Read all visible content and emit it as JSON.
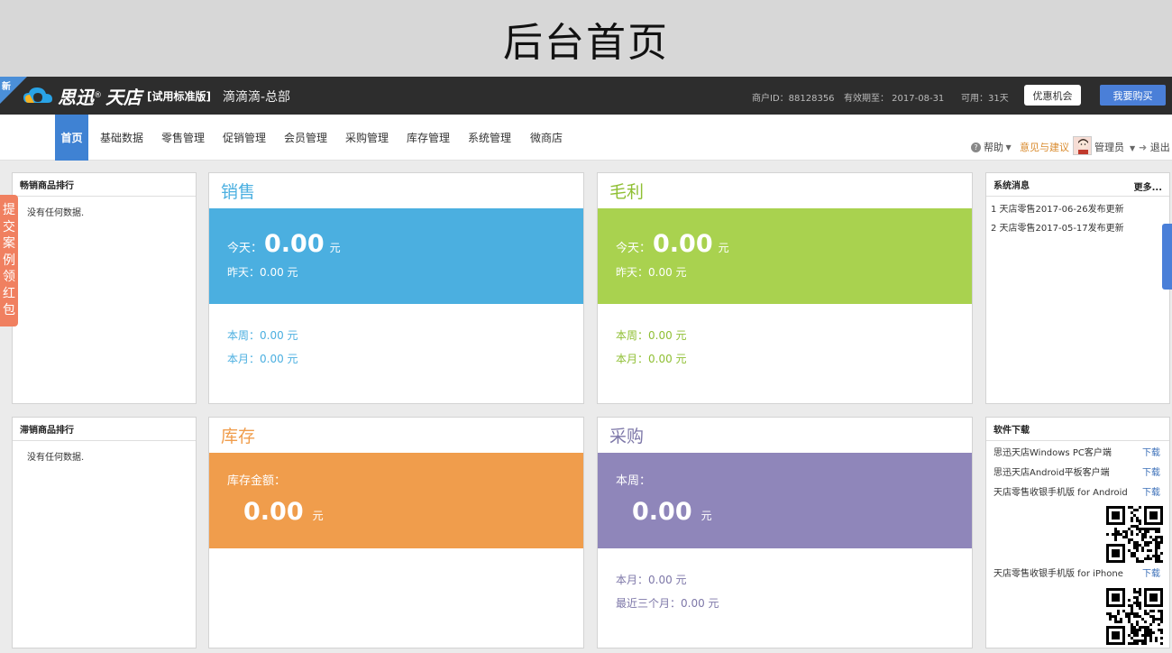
{
  "banner": {
    "title": "后台首页"
  },
  "header": {
    "new_tag": "新",
    "logo_main": "思迅",
    "logo_sup": "®",
    "logo_sub": "天店",
    "edition": "[试用标准版]",
    "store": "滴滴滴-总部",
    "merchant_id": "商户ID：88128356",
    "valid_until": "有效期至： 2017-08-31",
    "available": "可用：31天",
    "promo_label": "优惠机会",
    "buy_label": "我要购买"
  },
  "nav": {
    "items": [
      {
        "label": "首页",
        "active": true
      },
      {
        "label": "基础数据"
      },
      {
        "label": "零售管理"
      },
      {
        "label": "促销管理"
      },
      {
        "label": "会员管理"
      },
      {
        "label": "采购管理"
      },
      {
        "label": "库存管理"
      },
      {
        "label": "系统管理"
      },
      {
        "label": "微商店"
      }
    ],
    "help": "帮助",
    "feedback": "意见与建议",
    "admin": "管理员",
    "logout": "退出"
  },
  "hot_products": {
    "title": "畅销商品排行",
    "empty": "没有任何数据."
  },
  "slow_products": {
    "title": "滞销商品排行",
    "empty": "没有任何数据."
  },
  "sales": {
    "title": "销售",
    "today_label": "今天：",
    "today_value": "0.00",
    "unit": "元",
    "yesterday": "昨天：0.00 元",
    "week": "本周：0.00 元",
    "month": "本月：0.00 元"
  },
  "profit": {
    "title": "毛利",
    "today_label": "今天：",
    "today_value": "0.00",
    "unit": "元",
    "yesterday": "昨天：0.00 元",
    "week": "本周：0.00 元",
    "month": "本月：0.00 元"
  },
  "inventory": {
    "title": "库存",
    "amount_label": "库存金额：",
    "amount_value": "0.00",
    "unit": "元"
  },
  "purchase": {
    "title": "采购",
    "week_label": "本周：",
    "week_value": "0.00",
    "unit": "元",
    "month": "本月：0.00 元",
    "three_months": "最近三个月：0.00 元"
  },
  "messages": {
    "title": "系统消息",
    "more": "更多...",
    "items": [
      "1 天店零售2017-06-26发布更新",
      "2 天店零售2017-05-17发布更新"
    ]
  },
  "downloads": {
    "title": "软件下载",
    "link_label": "下载",
    "items": [
      "思迅天店Windows PC客户端",
      "思迅天店Android平板客户端",
      "天店零售收银手机版 for Android",
      "天店零售收银手机版 for iPhone"
    ]
  },
  "side_tab": {
    "chars": [
      "提",
      "交",
      "案",
      "例",
      "领",
      "红",
      "包"
    ]
  },
  "colors": {
    "sales": "#4bafe0",
    "profit": "#a9d24f",
    "inventory": "#f09d4c",
    "purchase": "#8f86ba",
    "nav_active": "#3f82d3"
  }
}
